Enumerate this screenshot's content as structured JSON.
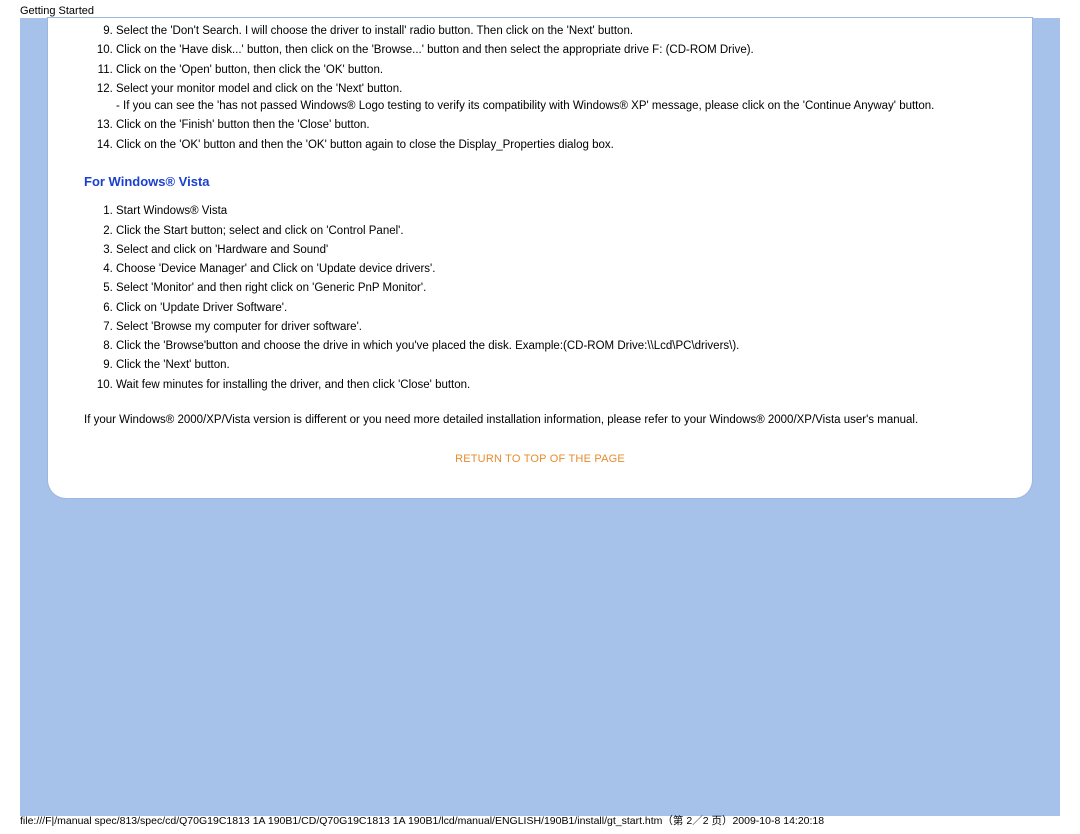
{
  "page": {
    "title_header": "Getting Started",
    "footer_path": "file:///F|/manual spec/813/spec/cd/Q70G19C1813 1A 190B1/CD/Q70G19C1813 1A 190B1/lcd/manual/ENGLISH/190B1/install/gt_start.htm（第 2／2 页）2009-10-8 14:20:18"
  },
  "xp_steps": {
    "start": 9,
    "items": [
      "Select the 'Don't Search. I will choose the driver to install' radio button. Then click on the 'Next' button.",
      "Click on the 'Have disk...' button, then click on the 'Browse...' button and then select the appropriate drive F: (CD-ROM Drive).",
      "Click on the 'Open' button, then click the 'OK' button.",
      "Select your monitor model and click on the 'Next' button.",
      "Click on the 'Finish' button then the 'Close' button.",
      "Click on the 'OK' button and then the 'OK' button again to close the Display_Properties dialog box."
    ],
    "step12_note": "- If you can see the 'has not passed Windows® Logo testing to verify its compatibility with Windows® XP' message, please click on the 'Continue Anyway' button."
  },
  "vista": {
    "heading": "For Windows® Vista",
    "items": [
      "Start Windows® Vista",
      "Click the Start button; select and click on 'Control Panel'.",
      "Select and click on 'Hardware and Sound'",
      "Choose 'Device Manager' and Click on 'Update device drivers'.",
      "Select 'Monitor' and then right click on 'Generic PnP Monitor'.",
      "Click on 'Update Driver Software'.",
      "Select 'Browse my computer for driver software'.",
      "Click the 'Browse'button and choose the drive in which you've placed the disk. Example:(CD-ROM Drive:\\\\Lcd\\PC\\drivers\\).",
      "Click the 'Next' button.",
      "Wait few minutes for installing the driver, and then click 'Close' button."
    ]
  },
  "closing_text": "If your Windows® 2000/XP/Vista version is different or you need more detailed installation information, please refer to your Windows® 2000/XP/Vista user's manual.",
  "return_link": "RETURN TO TOP OF THE PAGE"
}
